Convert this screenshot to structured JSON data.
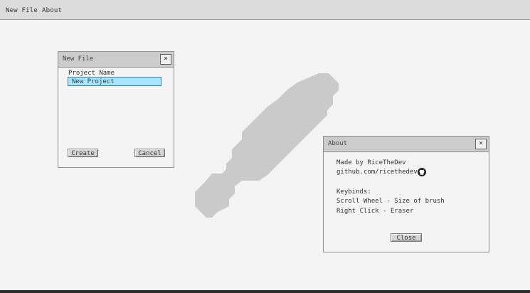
{
  "menubar": {
    "new_file": "New File",
    "about": "About"
  },
  "new_file_dialog": {
    "title": "New File",
    "close_label": "×",
    "project_name_label": "Project Name",
    "project_name_value": "New Project",
    "create_label": "Create",
    "cancel_label": "Cancel"
  },
  "about_dialog": {
    "title": "About",
    "close_label": "×",
    "made_by": "Made by RiceTheDev",
    "github": "github.com/ricethedev",
    "github_icon": "github-icon",
    "keybinds_heading": "Keybinds:",
    "keybind_scroll": "Scroll Wheel - Size of brush",
    "keybind_right_click": "Right Click - Eraser",
    "close_button_label": "Close"
  },
  "colors": {
    "background": "#f4f4f4",
    "menubar": "#dcdcdc",
    "titlebar": "#cccccc",
    "input_highlight": "#a8e6ff",
    "drawn_stroke": "#cacaca"
  }
}
